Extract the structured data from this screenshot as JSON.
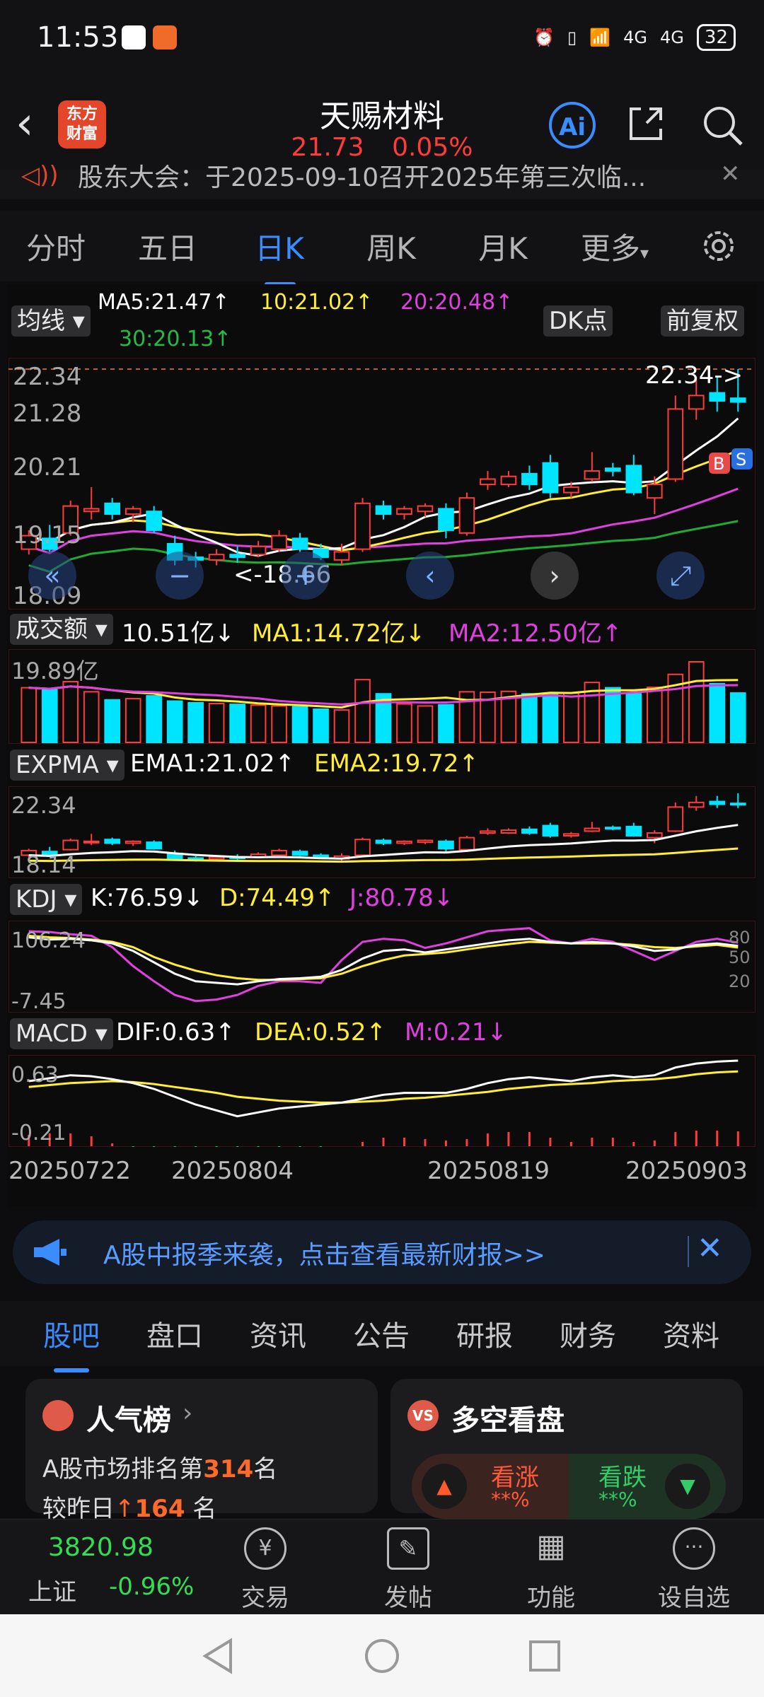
{
  "status": {
    "time": "11:53",
    "battery": "32",
    "network": "4G"
  },
  "header": {
    "stock_name": "天赐材料",
    "price": "21.73",
    "change_pct": "0.05%",
    "logo_line1": "东方",
    "logo_line2": "财富",
    "ai_label": "Ai"
  },
  "notice": {
    "text": "股东大会：于2025-09-10召开2025年第三次临..."
  },
  "period_tabs": [
    "分时",
    "五日",
    "日K",
    "周K",
    "月K",
    "更多"
  ],
  "active_period": "日K",
  "chart_controls": {
    "ma_chip": "均线",
    "dk_chip": "DK点",
    "adjust_chip": "前复权"
  },
  "ma_legend": {
    "ma5": "MA5:21.47↑",
    "ma10": "10:21.02↑",
    "ma20": "20:20.48↑",
    "ma30": "30:20.13↑"
  },
  "main_axis": {
    "high": "22.34",
    "l2": "21.28",
    "l3": "20.21",
    "l4": "19.15",
    "low": "18.09",
    "high_marker": "22.34->",
    "low_marker": "<-18.66",
    "buy_badge": "B",
    "sell_badge": "S"
  },
  "volume_panel": {
    "chip": "成交额",
    "value": "10.51亿↓",
    "ma1": "MA1:14.72亿↓",
    "ma2": "MA2:12.50亿↑",
    "axis_top": "19.89亿"
  },
  "expma_panel": {
    "chip": "EXPMA",
    "ema1": "EMA1:21.02↑",
    "ema2": "EMA2:19.72↑",
    "axis_top": "22.34",
    "axis_bottom": "18.14"
  },
  "kdj_panel": {
    "chip": "KDJ",
    "k": "K:76.59↓",
    "d": "D:74.49↑",
    "j": "J:80.78↓",
    "axis_top": "106.24",
    "axis_bottom": "-7.45",
    "ref80": "80",
    "ref50": "50",
    "ref20": "20"
  },
  "macd_panel": {
    "chip": "MACD",
    "dif": "DIF:0.63↑",
    "dea": "DEA:0.52↑",
    "m": "M:0.21↓",
    "axis_top": "0.63",
    "axis_bottom": "-0.21"
  },
  "dates": [
    "20250722",
    "20250804",
    "20250819",
    "20250903"
  ],
  "banner": {
    "text": "A股中报季来袭，点击查看最新财报>>"
  },
  "bottom_tabs": [
    "股吧",
    "盘口",
    "资讯",
    "公告",
    "研报",
    "财务",
    "资料"
  ],
  "active_bottom_tab": "股吧",
  "popularity_card": {
    "title": "人气榜",
    "line1_prefix": "A股市场排名第",
    "rank": "314",
    "line1_suffix": "名",
    "line2_prefix": "较昨日",
    "change": "164",
    "line2_suffix": "名"
  },
  "sentiment_card": {
    "title": "多空看盘",
    "bull_label": "看涨",
    "bull_value": "**%",
    "bear_label": "看跌",
    "bear_value": "**%"
  },
  "bottom_nav": {
    "index_value": "3820.98",
    "index_name": "上证",
    "index_change": "-0.96%",
    "items": [
      "交易",
      "发帖",
      "功能",
      "设自选"
    ]
  },
  "colors": {
    "up": "#ff3b3b",
    "down": "#00e5ff",
    "accent": "#3a8cff",
    "ma5": "#ffffff",
    "ma10": "#ffee33",
    "ma20": "#e040e0",
    "ma30": "#22aa33"
  },
  "chart_data": {
    "type": "candlestick",
    "x_range": [
      "20250722",
      "20250905"
    ],
    "price_axis": [
      18.09,
      22.34
    ],
    "ohlc": [
      {
        "o": 19.0,
        "h": 19.35,
        "l": 18.9,
        "c": 19.25
      },
      {
        "o": 19.2,
        "h": 19.45,
        "l": 18.95,
        "c": 19.0
      },
      {
        "o": 19.3,
        "h": 19.9,
        "l": 19.25,
        "c": 19.8
      },
      {
        "o": 19.7,
        "h": 20.15,
        "l": 19.55,
        "c": 19.75
      },
      {
        "o": 19.85,
        "h": 19.95,
        "l": 19.55,
        "c": 19.65
      },
      {
        "o": 19.65,
        "h": 19.8,
        "l": 19.5,
        "c": 19.75
      },
      {
        "o": 19.7,
        "h": 19.8,
        "l": 19.3,
        "c": 19.35
      },
      {
        "o": 19.1,
        "h": 19.25,
        "l": 18.7,
        "c": 18.8
      },
      {
        "o": 18.85,
        "h": 18.95,
        "l": 18.66,
        "c": 18.8
      },
      {
        "o": 18.8,
        "h": 19.0,
        "l": 18.7,
        "c": 18.9
      },
      {
        "o": 18.9,
        "h": 19.05,
        "l": 18.75,
        "c": 18.85
      },
      {
        "o": 18.9,
        "h": 19.15,
        "l": 18.85,
        "c": 19.05
      },
      {
        "o": 19.0,
        "h": 19.35,
        "l": 18.95,
        "c": 19.25
      },
      {
        "o": 19.2,
        "h": 19.3,
        "l": 18.95,
        "c": 19.0
      },
      {
        "o": 19.0,
        "h": 19.1,
        "l": 18.8,
        "c": 18.85
      },
      {
        "o": 18.8,
        "h": 19.1,
        "l": 18.7,
        "c": 18.95
      },
      {
        "o": 19.0,
        "h": 19.95,
        "l": 18.95,
        "c": 19.85
      },
      {
        "o": 19.8,
        "h": 19.9,
        "l": 19.55,
        "c": 19.65
      },
      {
        "o": 19.65,
        "h": 19.8,
        "l": 19.55,
        "c": 19.75
      },
      {
        "o": 19.7,
        "h": 19.85,
        "l": 19.6,
        "c": 19.8
      },
      {
        "o": 19.75,
        "h": 19.85,
        "l": 19.2,
        "c": 19.35
      },
      {
        "o": 19.3,
        "h": 20.05,
        "l": 19.25,
        "c": 19.95
      },
      {
        "o": 20.2,
        "h": 20.45,
        "l": 20.1,
        "c": 20.3
      },
      {
        "o": 20.2,
        "h": 20.45,
        "l": 20.15,
        "c": 20.35
      },
      {
        "o": 20.4,
        "h": 20.55,
        "l": 20.1,
        "c": 20.2
      },
      {
        "o": 20.6,
        "h": 20.75,
        "l": 19.95,
        "c": 20.05
      },
      {
        "o": 20.05,
        "h": 20.25,
        "l": 19.95,
        "c": 20.15
      },
      {
        "o": 20.3,
        "h": 20.8,
        "l": 20.25,
        "c": 20.45
      },
      {
        "o": 20.5,
        "h": 20.6,
        "l": 20.35,
        "c": 20.45
      },
      {
        "o": 20.55,
        "h": 20.75,
        "l": 20.0,
        "c": 20.05
      },
      {
        "o": 19.95,
        "h": 20.35,
        "l": 19.65,
        "c": 20.2
      },
      {
        "o": 20.3,
        "h": 21.85,
        "l": 20.25,
        "c": 21.6
      },
      {
        "o": 21.6,
        "h": 22.2,
        "l": 21.4,
        "c": 21.85
      },
      {
        "o": 21.9,
        "h": 22.2,
        "l": 21.55,
        "c": 21.75
      },
      {
        "o": 21.8,
        "h": 22.34,
        "l": 21.55,
        "c": 21.73
      }
    ],
    "volume_yi": [
      13.5,
      13.0,
      15.0,
      12.5,
      10.5,
      10.8,
      11.5,
      10.2,
      9.8,
      9.6,
      9.4,
      9.2,
      9.0,
      8.8,
      8.2,
      8.0,
      15.5,
      12.0,
      9.5,
      9.0,
      9.3,
      12.5,
      12.4,
      12.6,
      12.0,
      11.8,
      12.2,
      14.8,
      13.5,
      12.0,
      13.6,
      16.8,
      19.89,
      14.5,
      12.2
    ],
    "volume_max": 19.89,
    "kdj_axis": [
      -7.45,
      106.24
    ],
    "kdj": {
      "k": [
        88,
        85,
        86,
        84,
        80,
        70,
        55,
        40,
        30,
        28,
        26,
        30,
        33,
        34,
        36,
        45,
        60,
        70,
        72,
        68,
        72,
        76,
        80,
        84,
        86,
        82,
        80,
        82,
        80,
        76,
        70,
        72,
        78,
        80,
        76.59
      ],
      "d": [
        90,
        88,
        87,
        85,
        82,
        75,
        62,
        52,
        44,
        38,
        34,
        32,
        32,
        33,
        34,
        40,
        50,
        58,
        64,
        66,
        68,
        72,
        76,
        79,
        82,
        81,
        80,
        80,
        80,
        78,
        75,
        74,
        76,
        78,
        74.49
      ],
      "j": [
        96,
        95,
        92,
        90,
        75,
        50,
        30,
        12,
        4,
        6,
        12,
        24,
        30,
        30,
        28,
        58,
        82,
        86,
        84,
        74,
        80,
        88,
        96,
        98,
        100,
        84,
        80,
        86,
        82,
        70,
        58,
        70,
        82,
        86,
        80.78
      ]
    },
    "macd_axis": [
      -0.21,
      0.63
    ],
    "macd": {
      "dif": [
        0.42,
        0.45,
        0.48,
        0.47,
        0.44,
        0.4,
        0.34,
        0.26,
        0.18,
        0.12,
        0.06,
        0.1,
        0.14,
        0.16,
        0.18,
        0.2,
        0.24,
        0.28,
        0.3,
        0.3,
        0.3,
        0.34,
        0.4,
        0.44,
        0.46,
        0.44,
        0.42,
        0.46,
        0.48,
        0.46,
        0.48,
        0.56,
        0.6,
        0.62,
        0.63
      ],
      "dea": [
        0.36,
        0.38,
        0.4,
        0.41,
        0.42,
        0.41,
        0.39,
        0.36,
        0.33,
        0.3,
        0.26,
        0.24,
        0.22,
        0.21,
        0.2,
        0.2,
        0.21,
        0.22,
        0.24,
        0.25,
        0.27,
        0.29,
        0.31,
        0.34,
        0.36,
        0.38,
        0.39,
        0.4,
        0.42,
        0.43,
        0.44,
        0.46,
        0.49,
        0.51,
        0.52
      ],
      "m": [
        0.16,
        0.18,
        0.18,
        0.14,
        0.04,
        -0.02,
        -0.1,
        -0.2,
        -0.21,
        -0.18,
        -0.14,
        -0.1,
        -0.06,
        -0.05,
        -0.04,
        0.0,
        0.06,
        0.12,
        0.12,
        0.1,
        0.08,
        0.1,
        0.18,
        0.2,
        0.2,
        0.12,
        0.06,
        0.12,
        0.12,
        0.06,
        0.08,
        0.2,
        0.22,
        0.22,
        0.21
      ]
    }
  }
}
